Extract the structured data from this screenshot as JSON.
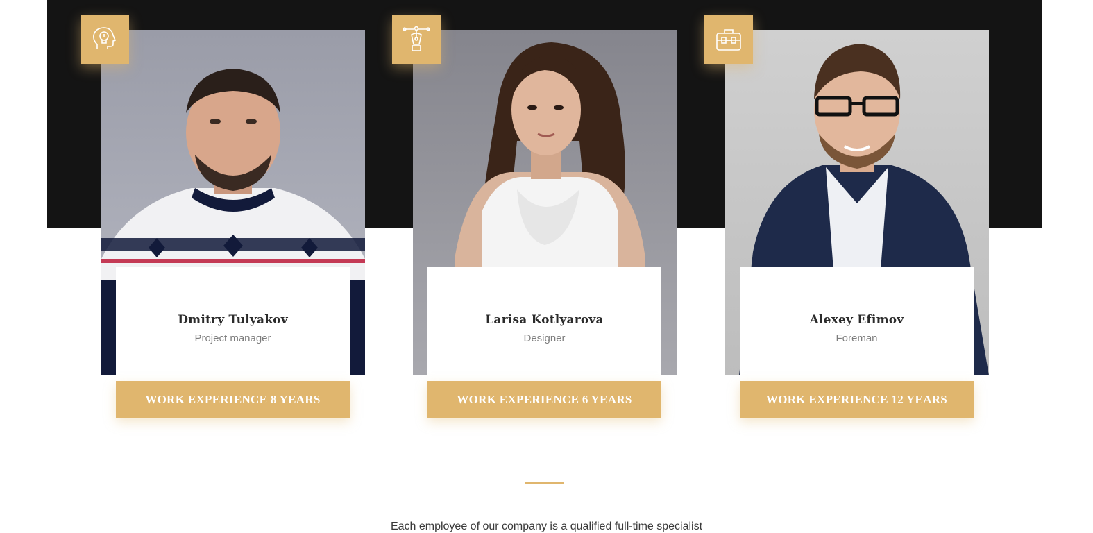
{
  "team": [
    {
      "name": "Dmitry Tulyakov",
      "role": "Project manager",
      "experience": "WORK EXPERIENCE 8 YEARS",
      "icon": "idea-head-icon",
      "photo_desc": "man in nordic sweater"
    },
    {
      "name": "Larisa Kotlyarova",
      "role": "Designer",
      "experience": "WORK EXPERIENCE 6 YEARS",
      "icon": "pen-tool-icon",
      "photo_desc": "woman in white top"
    },
    {
      "name": "Alexey Efimov",
      "role": "Foreman",
      "experience": "WORK EXPERIENCE 12 YEARS",
      "icon": "toolbox-icon",
      "photo_desc": "man in navy blazer with glasses"
    }
  ],
  "bottom_text": "Each employee of our company is a qualified full-time specialist",
  "colors": {
    "accent": "#e0b66e",
    "dark_band": "#141414",
    "text_dark": "#2b2b2b",
    "text_muted": "#7d7d7d"
  }
}
